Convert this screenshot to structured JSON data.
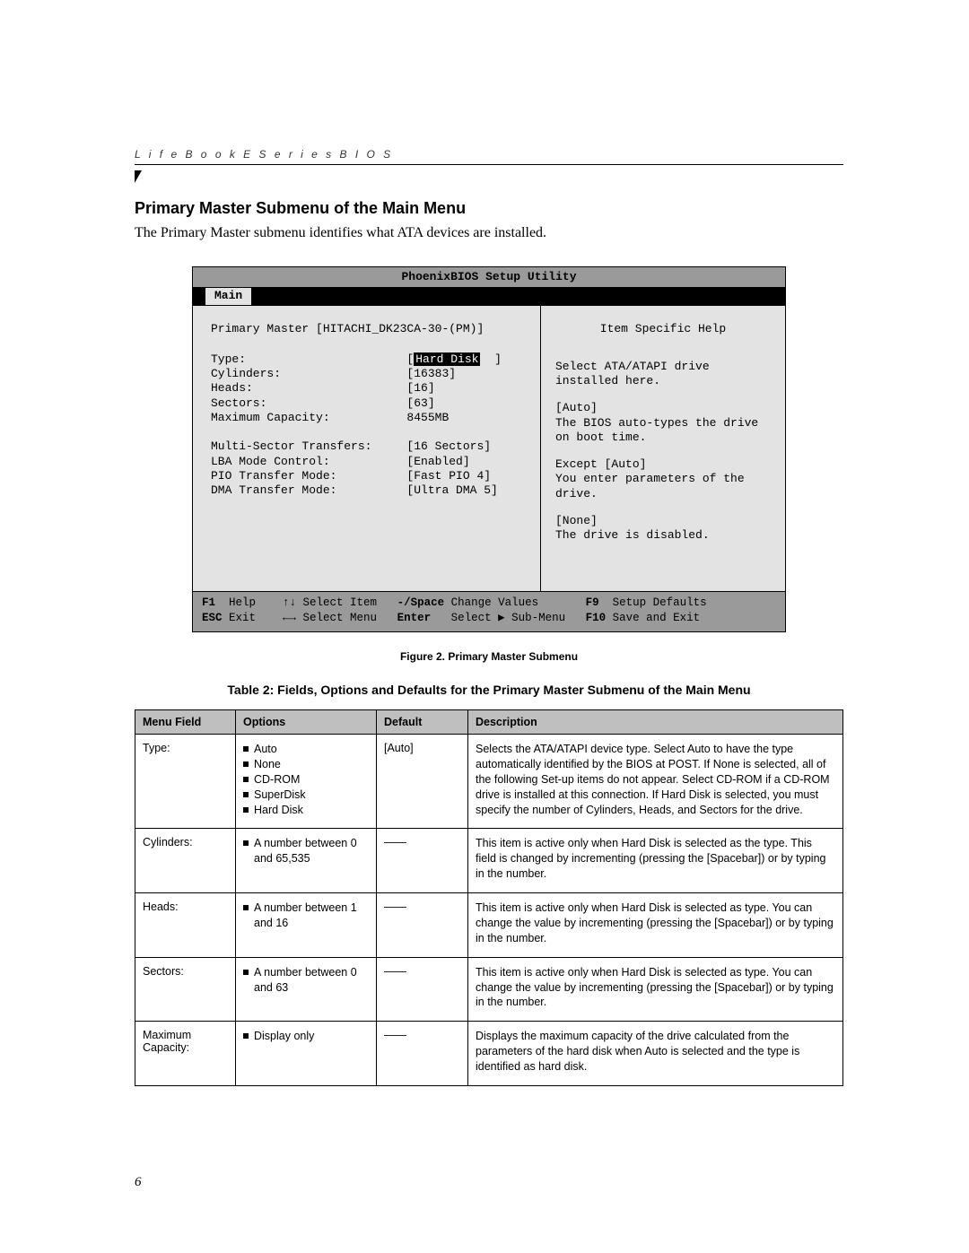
{
  "runningHead": "L i f e B o o k   E   S e r i e s   B I O S",
  "sectionTitle": "Primary Master Submenu of the Main Menu",
  "lead": "The Primary Master submenu identifies what ATA devices are installed.",
  "bios": {
    "utilityTitle": "PhoenixBIOS Setup Utility",
    "tab": "Main",
    "leftHeader": "Primary Master [HITACHI_DK23CA-30-(PM)]",
    "rightTitle": "Item Specific Help",
    "rows": [
      {
        "label": "Type:",
        "value": "Hard Disk",
        "bracketed": true,
        "highlight": true,
        "trail": "  ]"
      },
      {
        "label": "Cylinders:",
        "value": "[16383]"
      },
      {
        "label": "Heads:",
        "value": "[16]"
      },
      {
        "label": "Sectors:",
        "value": "[63]"
      },
      {
        "label": "Maximum Capacity:",
        "value": "8455MB"
      },
      {
        "label": "",
        "value": ""
      },
      {
        "label": "Multi-Sector Transfers:",
        "value": "[16 Sectors]"
      },
      {
        "label": "LBA Mode Control:",
        "value": "[Enabled]"
      },
      {
        "label": "PIO Transfer Mode:",
        "value": "[Fast PIO 4]"
      },
      {
        "label": "DMA Transfer Mode:",
        "value": "[Ultra DMA 5]"
      }
    ],
    "help": [
      "Select ATA/ATAPI drive installed here.",
      "[Auto]\nThe BIOS auto-types the drive on boot time.",
      "Except [Auto]\nYou enter parameters of the drive.",
      "[None]\nThe drive is disabled."
    ],
    "footer": {
      "line1": {
        "k1": "F1",
        "l1": "Help",
        "k2": "↑↓",
        "l2": "Select Item",
        "k3": "-/Space",
        "l3": "Change Values",
        "k4": "F9",
        "l4": "Setup Defaults"
      },
      "line2": {
        "k1": "ESC",
        "l1": "Exit",
        "k2": "←→",
        "l2": "Select Menu",
        "k3": "Enter",
        "l3": "Select ▶ Sub-Menu",
        "k4": "F10",
        "l4": "Save and Exit"
      }
    }
  },
  "figureCaption": "Figure 2.  Primary Master Submenu",
  "tableTitle": "Table 2: Fields, Options and Defaults for the Primary Master Submenu of the Main Menu",
  "headers": {
    "c1": "Menu Field",
    "c2": "Options",
    "c3": "Default",
    "c4": "Description"
  },
  "tableRows": [
    {
      "field": "Type:",
      "options": [
        "Auto",
        "None",
        "CD-ROM",
        "SuperDisk",
        "Hard Disk"
      ],
      "default": "[Auto]",
      "desc": "Selects the ATA/ATAPI device type. Select Auto to have the type automatically identified by the BIOS at POST. If None is selected, all of the following Set-up items do not appear. Select CD-ROM if a CD-ROM drive is installed at this connection. If Hard Disk is selected, you must specify the number of Cylinders, Heads, and Sectors for the drive."
    },
    {
      "field": "Cylinders:",
      "options": [
        "A number between 0 and 65,535"
      ],
      "default": "——",
      "desc": "This item is active only when Hard Disk is selected as the type. This field is changed by incrementing (pressing the [Spacebar]) or by typing in the number."
    },
    {
      "field": "Heads:",
      "options": [
        "A number between 1 and 16"
      ],
      "default": "——",
      "desc": "This item is active only when Hard Disk is selected as type. You can change the value by incrementing (pressing the [Spacebar]) or by typing in the number."
    },
    {
      "field": "Sectors:",
      "options": [
        "A number between 0 and 63"
      ],
      "default": "——",
      "desc": "This item is active only when Hard Disk is selected as type. You can change the value by incrementing (pressing the [Spacebar]) or by typing in the number."
    },
    {
      "field": "Maximum Capacity:",
      "options": [
        "Display only"
      ],
      "default": "——",
      "desc": "Displays the maximum capacity of the drive calculated from the parameters of the hard disk when Auto is selected and the type is identified as hard disk."
    }
  ],
  "pageNumber": "6"
}
